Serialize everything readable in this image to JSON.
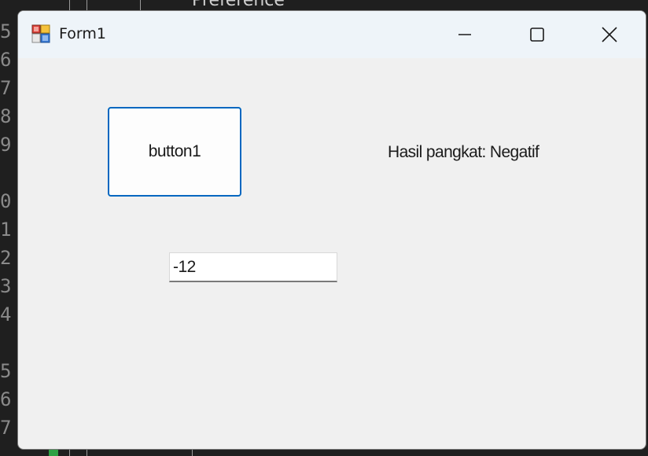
{
  "background": {
    "top_text": "Preference",
    "line_numbers": [
      "5",
      "6",
      "7",
      "8",
      "9",
      "",
      "0",
      "1",
      "2",
      "3",
      "4",
      "",
      "5",
      "6",
      "7"
    ]
  },
  "window": {
    "title": "Form1",
    "icon": "winforms-app-icon",
    "controls": {
      "minimize_icon": "minimize-icon",
      "maximize_icon": "maximize-icon",
      "close_icon": "close-icon"
    }
  },
  "form": {
    "button_label": "button1",
    "result_label": "Hasil pangkat: Negatif",
    "input_value": "-12"
  },
  "colors": {
    "accent": "#0067c0",
    "titlebar": "#eef4f9",
    "client": "#f0f0f0"
  }
}
